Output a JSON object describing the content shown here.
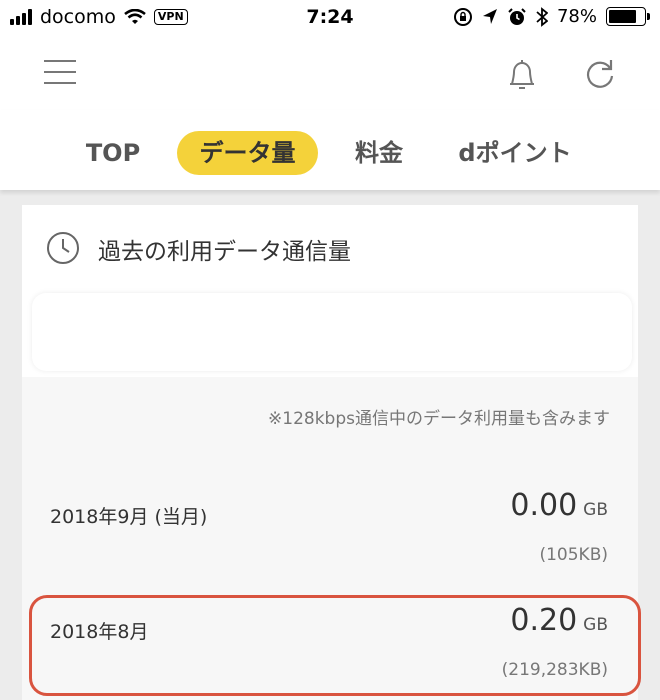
{
  "status_bar": {
    "carrier": "docomo",
    "vpn": "VPN",
    "time": "7:24",
    "battery": "78%",
    "battery_level": 0.78
  },
  "tabs": [
    {
      "label": "TOP",
      "active": false
    },
    {
      "label": "データ量",
      "active": true
    },
    {
      "label": "料金",
      "active": false
    },
    {
      "label": "dポイント",
      "active": false
    }
  ],
  "colors": {
    "accent": "#f4d23a",
    "highlight": "#d9543f",
    "background": "#ececec"
  },
  "card": {
    "title": "過去の利用データ通信量",
    "note": "※128kbps通信中のデータ利用量も含みます",
    "rows": [
      {
        "label": "2018年9月 (当月)",
        "value": "0.00",
        "unit": "GB",
        "sub": "(105KB)"
      },
      {
        "label": "2018年8月",
        "value": "0.20",
        "unit": "GB",
        "sub": "(219,283KB)"
      }
    ]
  }
}
